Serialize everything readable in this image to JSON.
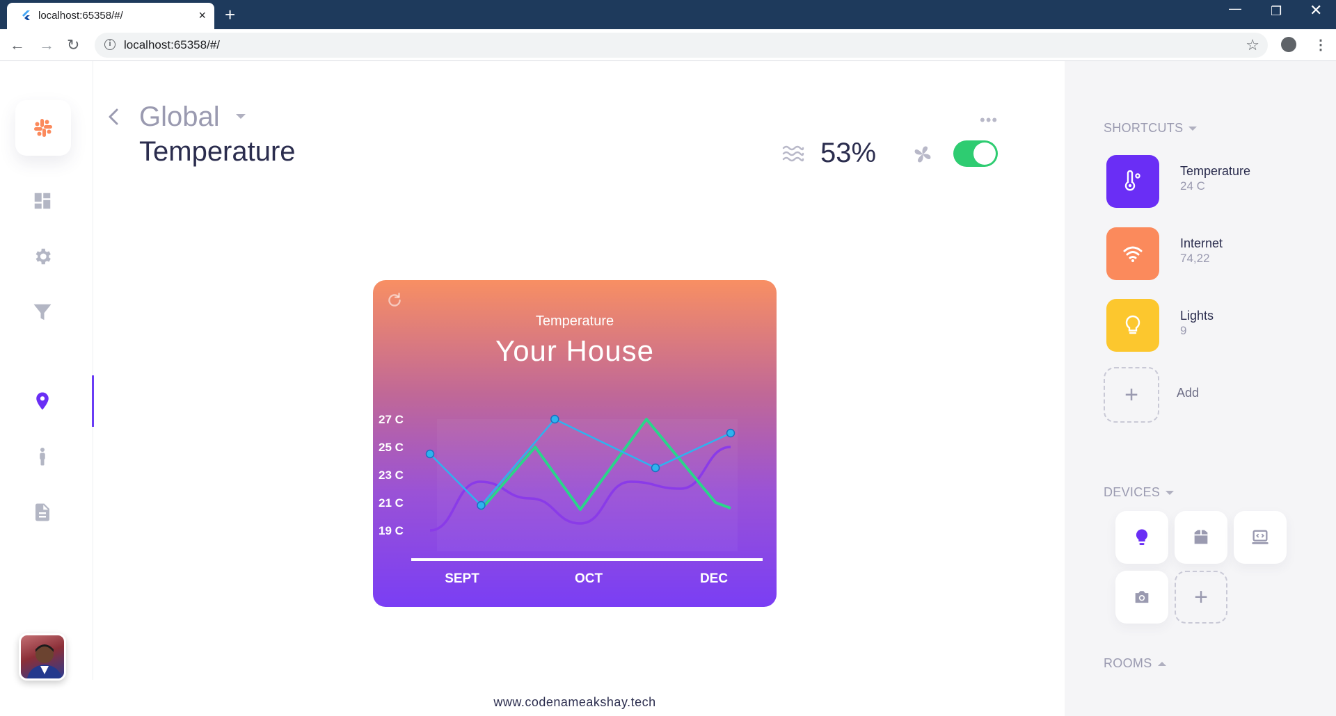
{
  "browser": {
    "tab_title": "localhost:65358/#/",
    "url": "localhost:65358/#/",
    "tab_close": "×",
    "new_tab": "+"
  },
  "header": {
    "global": "Global",
    "title": "Temperature",
    "more": "•••",
    "humidity": "53%",
    "fan_on": true
  },
  "card": {
    "subtitle": "Temperature",
    "title": "Your House"
  },
  "chart_data": {
    "type": "line",
    "title": "Your House",
    "y_ticks": [
      "27 C",
      "25 C",
      "23 C",
      "21 C",
      "19 C"
    ],
    "y_values": [
      27,
      25,
      23,
      21,
      19
    ],
    "x_ticks": [
      "SEPT",
      "OCT",
      "DEC"
    ],
    "ylim": [
      17.5,
      28
    ],
    "x": [
      0,
      1,
      2,
      3,
      4,
      5,
      6
    ],
    "series": [
      {
        "color": "#2ad58a",
        "values": [
          null,
          20.5,
          25,
          20.5,
          27,
          21,
          20.6
        ],
        "points_x": [
          0.05,
          0.17,
          0.35,
          0.5,
          0.72,
          0.95,
          1.0
        ]
      },
      {
        "color": "#2eb3ef",
        "values": [
          24.5,
          20.8,
          27,
          23.5,
          26
        ],
        "points_x": [
          0,
          0.17,
          0.415,
          0.75,
          1.0
        ]
      },
      {
        "color": "#8a3be8",
        "values": [
          19,
          22.5,
          21.3,
          19.5,
          22.5,
          22,
          25
        ]
      }
    ]
  },
  "footer": "www.codenameakshay.tech",
  "shortcuts": {
    "title": "SHORTCUTS",
    "items": [
      {
        "label": "Temperature",
        "value": "24 C",
        "color": "#6a2ef5"
      },
      {
        "label": "Internet",
        "value": "74,22",
        "color": "#fb8a5c"
      },
      {
        "label": "Lights",
        "value": "9",
        "color": "#fcc72e"
      }
    ],
    "add_label": "Add"
  },
  "devices": {
    "title": "DEVICES"
  },
  "rooms": {
    "title": "ROOMS"
  },
  "icons": {
    "accent": "#6a2ef5"
  }
}
